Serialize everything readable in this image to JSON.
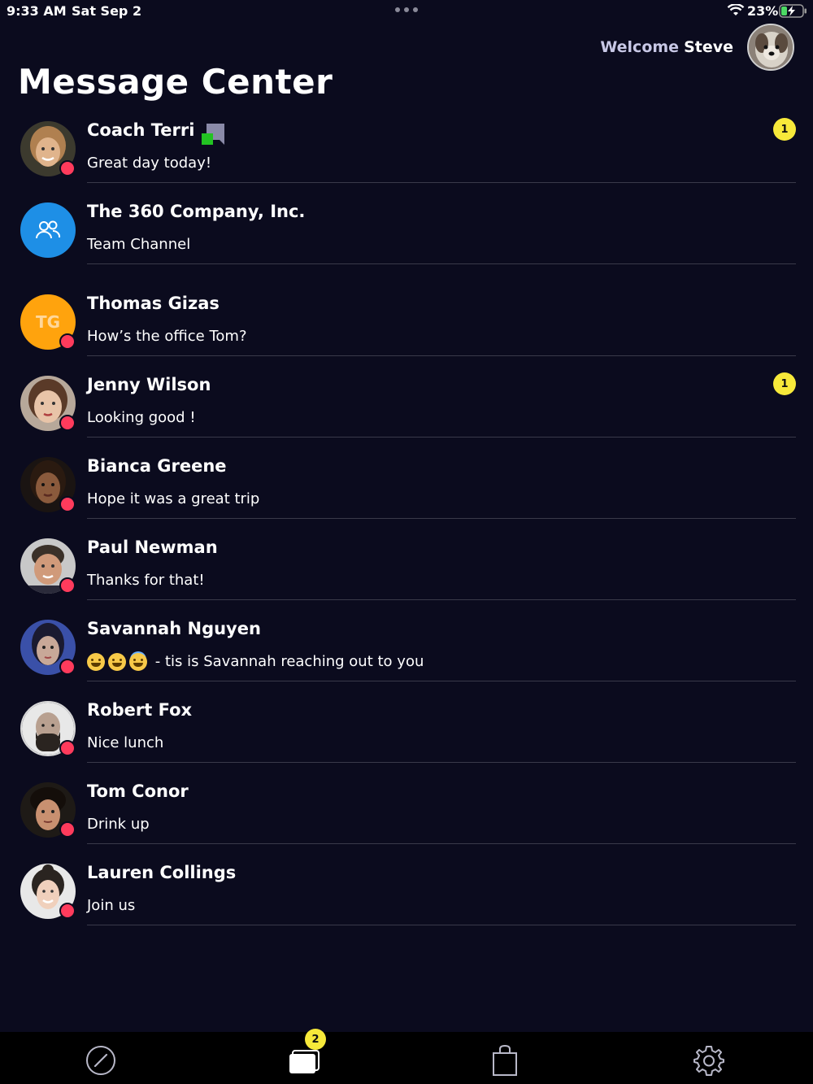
{
  "status_bar": {
    "time": "9:33 AM",
    "date": "Sat Sep 2",
    "battery": "23%"
  },
  "header": {
    "welcome": "Welcome",
    "user_name": "Steve",
    "title": "Message Center"
  },
  "conversations": [
    {
      "name": "Coach Terri",
      "preview": "Great day today!",
      "unread": "1",
      "avatar": "photo",
      "online_dot": true,
      "flag": true
    },
    {
      "name": "The 360 Company, Inc.",
      "preview": "Team Channel",
      "avatar": "team-icon",
      "online_dot": false
    },
    {
      "name": "Thomas Gizas",
      "preview": "How’s the office Tom?",
      "avatar_initials": "TG",
      "online_dot": true
    },
    {
      "name": "Jenny Wilson",
      "preview": "Looking good !",
      "unread": "1",
      "avatar": "photo",
      "online_dot": true
    },
    {
      "name": "Bianca Greene",
      "preview": "Hope it was a great trip",
      "avatar": "photo",
      "online_dot": true
    },
    {
      "name": "Paul Newman",
      "preview": "Thanks for that!",
      "avatar": "photo",
      "online_dot": true
    },
    {
      "name": "Savannah Nguyen",
      "preview": "- tis is Savannah reaching out to you",
      "preview_emojis": [
        "grin",
        "yum",
        "halo"
      ],
      "avatar": "photo",
      "online_dot": true
    },
    {
      "name": "Robert Fox",
      "preview": "Nice lunch",
      "avatar": "photo",
      "online_dot": true
    },
    {
      "name": "Tom Conor",
      "preview": "Drink up",
      "avatar": "photo",
      "online_dot": true
    },
    {
      "name": "Lauren Collings",
      "preview": "Join us",
      "avatar": "photo",
      "online_dot": true
    }
  ],
  "tab_bar": {
    "items": [
      "dashboard-icon",
      "messages-icon",
      "shop-bag-icon",
      "settings-icon"
    ],
    "messages_badge": "2"
  },
  "colors": {
    "background": "#0b0b1e",
    "badge": "#f7e93a",
    "online_dot": "#ff3b5c",
    "initials_avatar": "#ffa30d",
    "team_avatar": "#1e8fe6"
  }
}
